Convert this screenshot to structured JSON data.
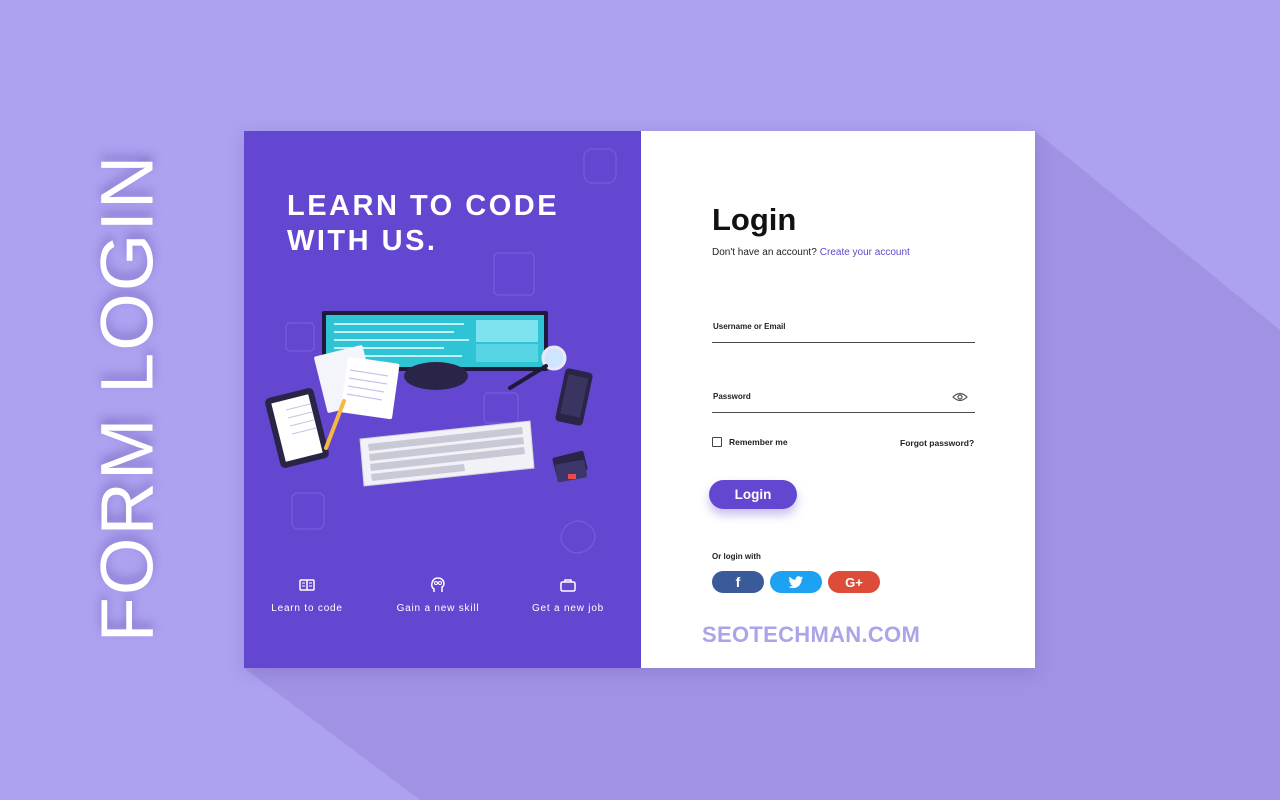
{
  "banner": {
    "title": "FORM LOGIN"
  },
  "left_panel": {
    "headline_line1": "LEARN TO CODE",
    "headline_line2": "WITH US.",
    "features": [
      {
        "icon": "book-icon",
        "label": "Learn to code"
      },
      {
        "icon": "head-idea-icon",
        "label": "Gain a new skill"
      },
      {
        "icon": "briefcase-icon",
        "label": "Get a new job"
      }
    ]
  },
  "login": {
    "title": "Login",
    "signup_prompt": "Don't have an account?",
    "signup_link": "Create your account",
    "username_label": "Username or Email",
    "password_label": "Password",
    "remember_label": "Remember me",
    "forgot_label": "Forgot password?",
    "submit_label": "Login",
    "social_prompt": "Or login with",
    "social": [
      {
        "name": "facebook",
        "glyph": "f"
      },
      {
        "name": "twitter",
        "glyph": ""
      },
      {
        "name": "google-plus",
        "glyph": "G+"
      }
    ]
  },
  "watermark": "SEOTECHMAN.COM",
  "colors": {
    "background": "#ada2f0",
    "accent": "#6347d0",
    "facebook": "#3b5a99",
    "twitter": "#1da1f2",
    "google_plus": "#dd4b39"
  }
}
